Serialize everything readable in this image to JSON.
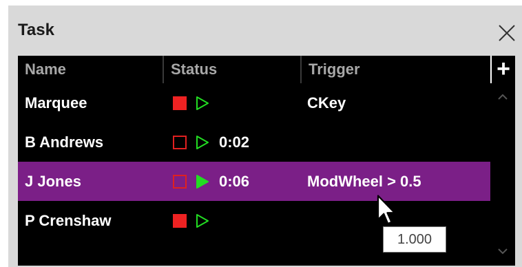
{
  "panel": {
    "title": "Task"
  },
  "table": {
    "columns": [
      "Name",
      "Status",
      "Trigger"
    ],
    "add_label": "+",
    "rows": [
      {
        "name": "Marquee",
        "stop_style": "filled",
        "play_style": "outline",
        "time": "",
        "trigger": "CKey",
        "selected": false
      },
      {
        "name": "B Andrews",
        "stop_style": "outline",
        "play_style": "outline",
        "time": "0:02",
        "trigger": "",
        "selected": false
      },
      {
        "name": "J Jones",
        "stop_style": "outline",
        "play_style": "filled",
        "time": "0:06",
        "trigger": "ModWheel > 0.5",
        "selected": true
      },
      {
        "name": "P Crenshaw",
        "stop_style": "filled",
        "play_style": "outline",
        "time": "",
        "trigger": "",
        "selected": false
      }
    ]
  },
  "tooltip": {
    "text": "1.000"
  },
  "colors": {
    "selected_row": "#7b1f87",
    "stop_red": "#ee2222",
    "play_green": "#22dd22",
    "header_text": "#a8a8a8"
  },
  "icons": {
    "close": "close-icon",
    "add": "plus-icon",
    "stop": "stop-icon",
    "play": "play-icon",
    "scroll_up": "chevron-up-icon",
    "scroll_down": "chevron-down-icon",
    "cursor": "mouse-cursor-icon"
  }
}
